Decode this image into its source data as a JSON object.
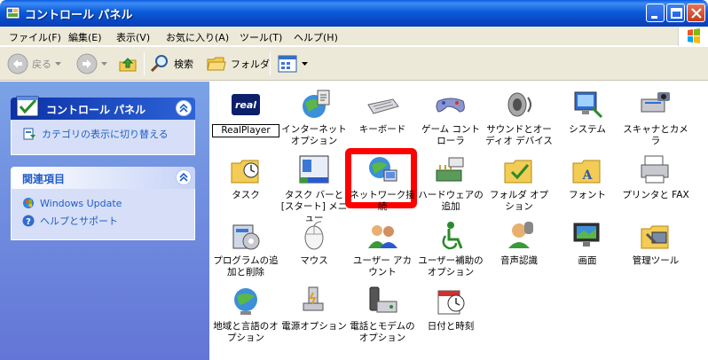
{
  "window": {
    "title": "コントロール パネル"
  },
  "menu": [
    "ファイル(F)",
    "編集(E)",
    "表示(V)",
    "お気に入り(A)",
    "ツール(T)",
    "ヘルプ(H)"
  ],
  "toolbar": {
    "back": "戻る",
    "search": "検索",
    "folders": "フォルダ"
  },
  "taskpane": {
    "main_title": "コントロール パネル",
    "switch_view": "カテゴリの表示に切り替える",
    "related_title": "関連項目",
    "related": [
      "Windows Update",
      "ヘルプとサポート"
    ]
  },
  "items": [
    {
      "label": "RealPlayer",
      "icon": "realplayer-icon"
    },
    {
      "label": "インターネット オプション",
      "icon": "internet-options-icon"
    },
    {
      "label": "キーボード",
      "icon": "keyboard-icon"
    },
    {
      "label": "ゲーム コントローラ",
      "icon": "game-controller-icon"
    },
    {
      "label": "サウンドとオーディオ デバイス",
      "icon": "speaker-icon"
    },
    {
      "label": "システム",
      "icon": "system-icon"
    },
    {
      "label": "スキャナとカメラ",
      "icon": "scanner-camera-icon"
    },
    {
      "label": "タスク",
      "icon": "scheduled-tasks-icon"
    },
    {
      "label": "タスク バーと [スタート] メニュー",
      "icon": "taskbar-icon"
    },
    {
      "label": "ネットワーク接続",
      "icon": "network-connections-icon",
      "highlighted": true
    },
    {
      "label": "ハードウェアの追加",
      "icon": "add-hardware-icon"
    },
    {
      "label": "フォルダ オプション",
      "icon": "folder-options-icon"
    },
    {
      "label": "フォント",
      "icon": "fonts-folder-icon"
    },
    {
      "label": "プリンタと FAX",
      "icon": "printer-icon"
    },
    {
      "label": "プログラムの追加と削除",
      "icon": "add-remove-programs-icon"
    },
    {
      "label": "マウス",
      "icon": "mouse-icon"
    },
    {
      "label": "ユーザー アカウント",
      "icon": "user-accounts-icon"
    },
    {
      "label": "ユーザー補助のオプション",
      "icon": "accessibility-icon"
    },
    {
      "label": "音声認識",
      "icon": "speech-icon"
    },
    {
      "label": "画面",
      "icon": "display-icon"
    },
    {
      "label": "管理ツール",
      "icon": "admin-tools-icon"
    },
    {
      "label": "地域と言語のオプション",
      "icon": "regional-globe-icon"
    },
    {
      "label": "電源オプション",
      "icon": "power-options-icon"
    },
    {
      "label": "電話とモデムのオプション",
      "icon": "phone-modem-icon"
    },
    {
      "label": "日付と時刻",
      "icon": "date-time-icon"
    }
  ],
  "colors": {
    "titlebar": "#0a5ce0",
    "taskpane": "#7ba2e7",
    "link": "#215dc6",
    "highlight": "#ff0000"
  }
}
